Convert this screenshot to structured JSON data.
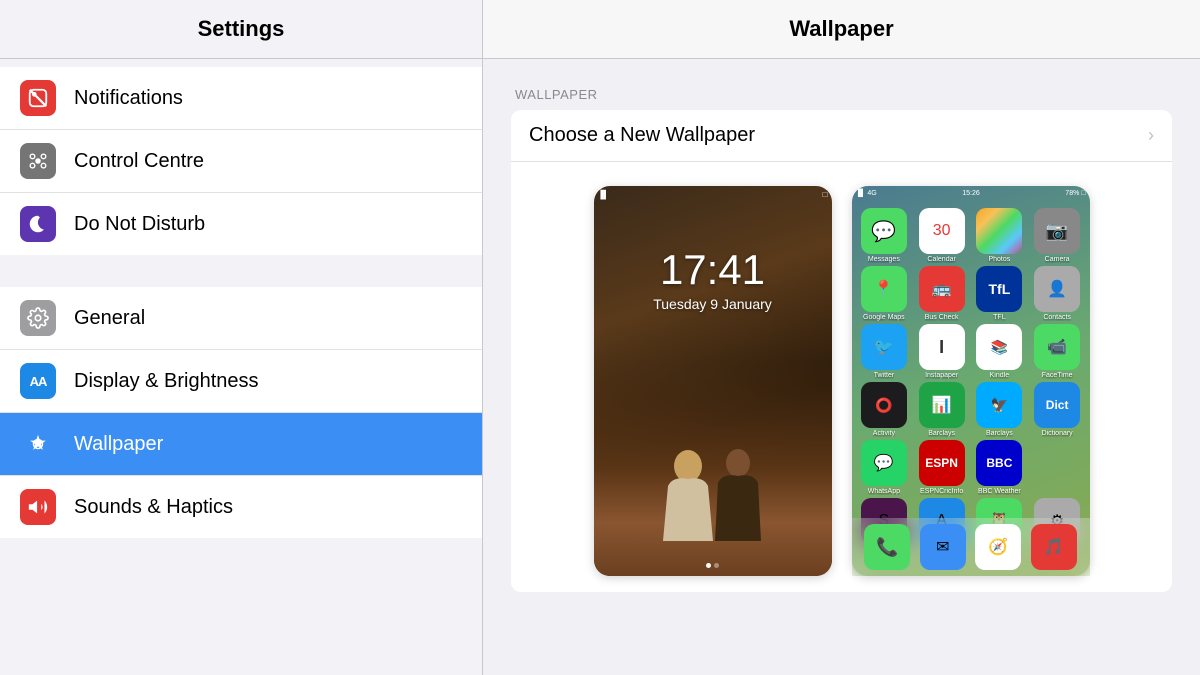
{
  "sidebar": {
    "title": "Settings",
    "items": [
      {
        "id": "notifications",
        "label": "Notifications",
        "icon_color": "#e53935",
        "icon_symbol": "🔔",
        "icon_class": "icon-notifications",
        "active": false
      },
      {
        "id": "control-centre",
        "label": "Control Centre",
        "icon_color": "#757575",
        "icon_symbol": "⚙",
        "icon_class": "icon-control-centre",
        "active": false
      },
      {
        "id": "do-not-disturb",
        "label": "Do Not Disturb",
        "icon_color": "#5e35b1",
        "icon_symbol": "🌙",
        "icon_class": "icon-do-not-disturb",
        "active": false
      },
      {
        "id": "general",
        "label": "General",
        "icon_color": "#9e9ea0",
        "icon_symbol": "⚙",
        "icon_class": "icon-general",
        "active": false
      },
      {
        "id": "display",
        "label": "Display & Brightness",
        "icon_color": "#1e88e5",
        "icon_symbol": "AA",
        "icon_class": "icon-display",
        "active": false
      },
      {
        "id": "wallpaper",
        "label": "Wallpaper",
        "icon_color": "#3b8ef3",
        "icon_symbol": "✦",
        "icon_class": "icon-wallpaper",
        "active": true
      },
      {
        "id": "sounds",
        "label": "Sounds & Haptics",
        "icon_color": "#e53935",
        "icon_symbol": "🔊",
        "icon_class": "icon-sounds",
        "active": false
      }
    ]
  },
  "panel": {
    "title": "Wallpaper",
    "section_label": "WALLPAPER",
    "choose_label": "Choose a New Wallpaper",
    "lockscreen_time": "17:41",
    "lockscreen_date": "Tuesday 9 January",
    "dots": [
      true,
      false
    ]
  }
}
